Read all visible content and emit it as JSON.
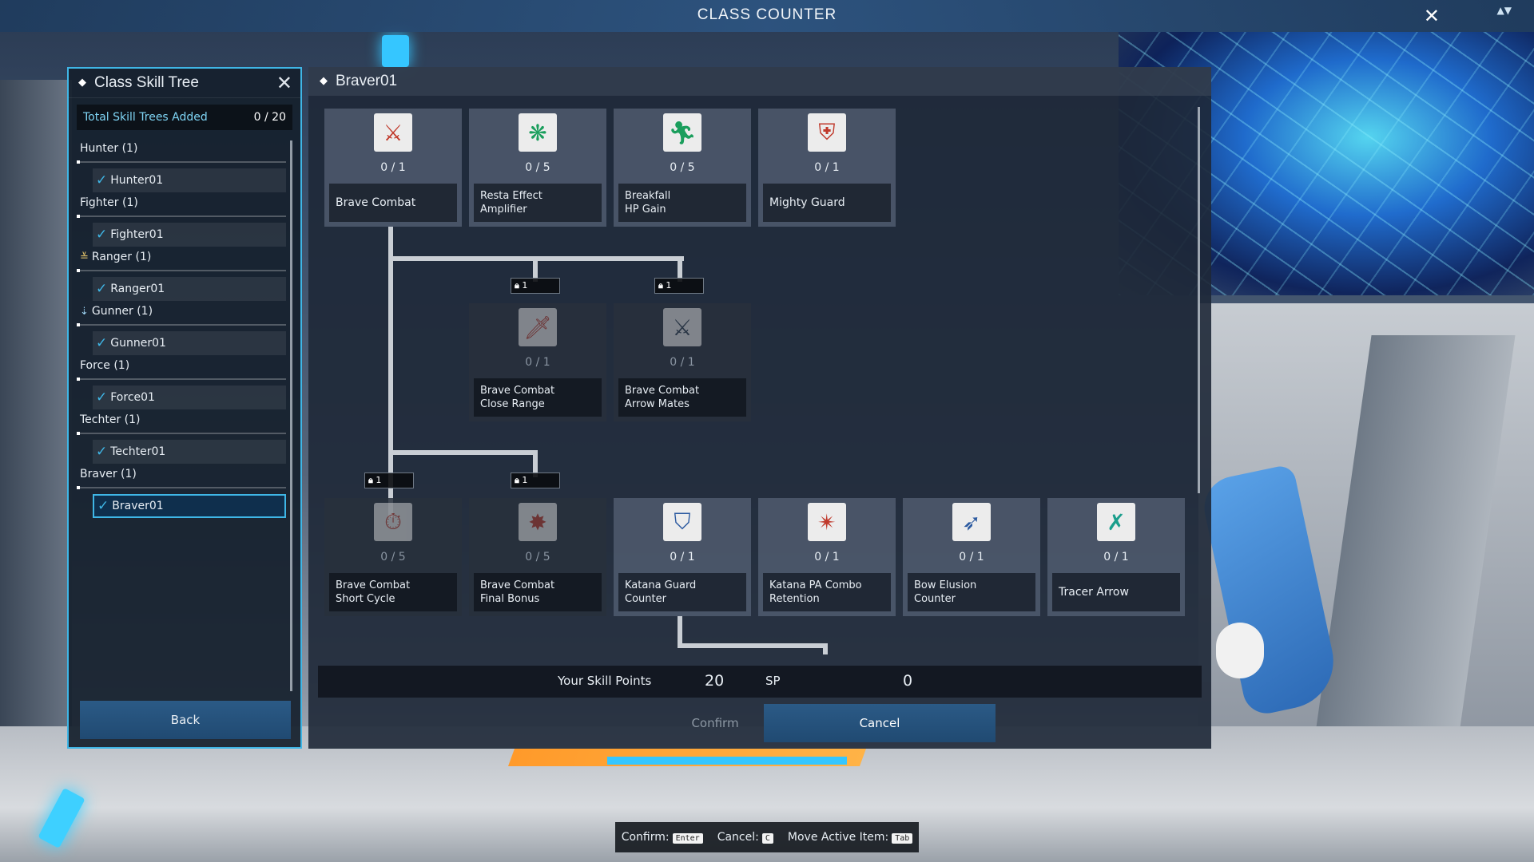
{
  "window": {
    "title": "CLASS COUNTER",
    "close_glyph": "✕",
    "mini_glyph": "▲▼"
  },
  "sidebar": {
    "title": "Class Skill Tree",
    "total_label": "Total Skill Trees Added",
    "total_value": "0 / 20",
    "classes": [
      {
        "name": "Hunter (1)",
        "tree": "Hunter01",
        "icon": ""
      },
      {
        "name": "Fighter (1)",
        "tree": "Fighter01",
        "icon": ""
      },
      {
        "name": "Ranger (1)",
        "tree": "Ranger01",
        "icon": "ranger-emblem-icon"
      },
      {
        "name": "Gunner (1)",
        "tree": "Gunner01",
        "icon": "gunner-emblem-icon"
      },
      {
        "name": "Force (1)",
        "tree": "Force01",
        "icon": ""
      },
      {
        "name": "Techter (1)",
        "tree": "Techter01",
        "icon": ""
      },
      {
        "name": "Braver (1)",
        "tree": "Braver01",
        "icon": "",
        "selected": true
      }
    ],
    "back_label": "Back"
  },
  "main": {
    "title": "Braver01",
    "skills": {
      "brave_combat": {
        "count": "0 / 1",
        "name": "Brave Combat"
      },
      "resta_effect": {
        "count": "0 / 5",
        "name": "Resta Effect\nAmplifier"
      },
      "breakfall": {
        "count": "0 / 5",
        "name": "Breakfall\nHP Gain"
      },
      "mighty_guard": {
        "count": "0 / 1",
        "name": "Mighty Guard"
      },
      "close_range": {
        "count": "0 / 1",
        "name": "Brave Combat\nClose Range"
      },
      "arrow_mates": {
        "count": "0 / 1",
        "name": "Brave Combat\nArrow Mates"
      },
      "short_cycle": {
        "count": "0 / 5",
        "name": "Brave Combat\nShort Cycle"
      },
      "final_bonus": {
        "count": "0 / 5",
        "name": "Brave Combat\nFinal Bonus"
      },
      "katana_guard": {
        "count": "0 / 1",
        "name": "Katana Guard\nCounter"
      },
      "katana_pa": {
        "count": "0 / 1",
        "name": "Katana PA Combo\nRetention"
      },
      "bow_elusion": {
        "count": "0 / 1",
        "name": "Bow Elusion\nCounter"
      },
      "tracer_arrow": {
        "count": "0 / 1",
        "name": "Tracer Arrow"
      }
    },
    "lock_level": "1",
    "skill_points_label": "Your Skill Points",
    "skill_points_value": "20",
    "sp_label": "SP",
    "sp_value": "0",
    "confirm_label": "Confirm",
    "cancel_label": "Cancel"
  },
  "hints": {
    "confirm": "Confirm:",
    "confirm_key": "Enter",
    "cancel": "Cancel:",
    "cancel_key": "C",
    "move": "Move Active Item:",
    "move_key": "Tab"
  },
  "colors": {
    "accent": "#3fb6e6",
    "button": "#2b5a86"
  }
}
